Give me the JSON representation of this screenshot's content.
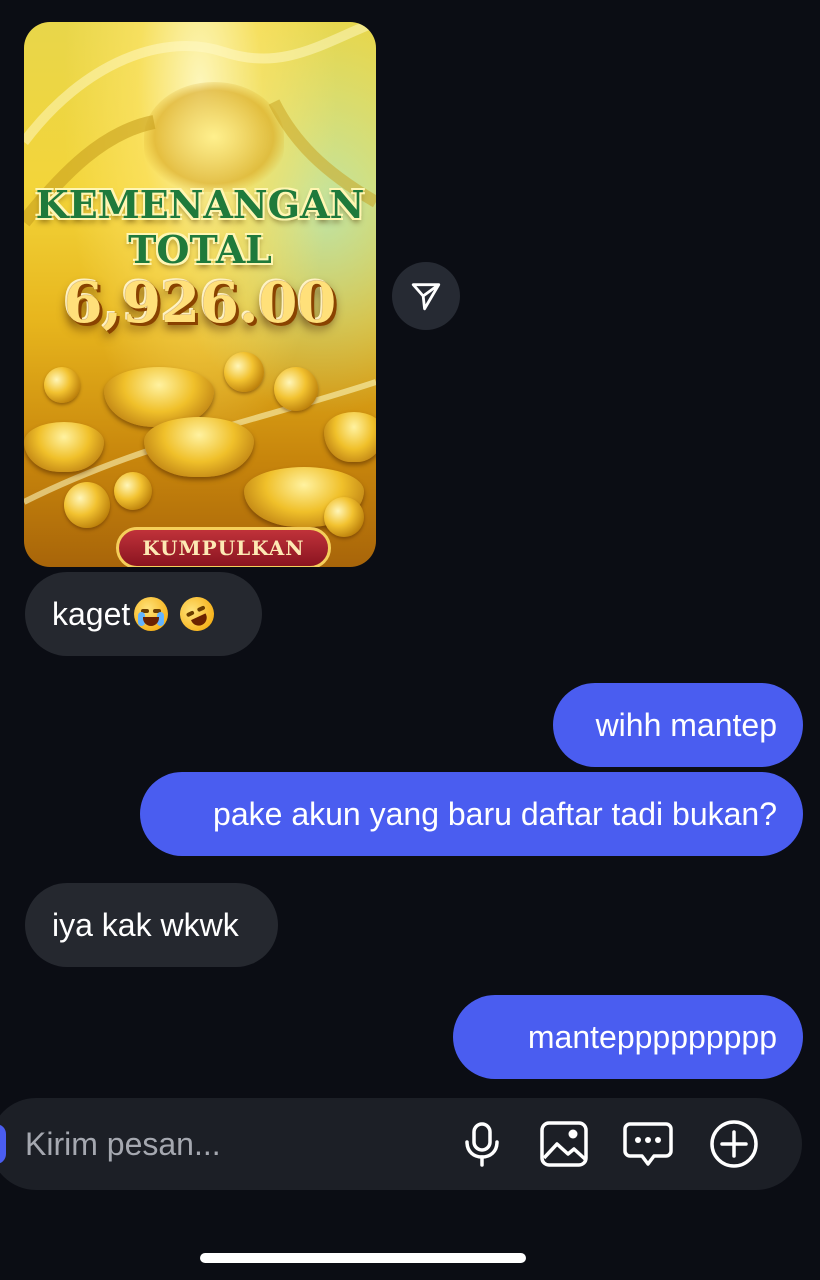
{
  "chat": {
    "image_message": {
      "title_line1": "KEMENANGAN",
      "title_line2": "TOTAL",
      "amount": "6,926.00",
      "button_label": "KUMPULKAN"
    },
    "messages": [
      {
        "from": "them",
        "text": "kaget",
        "emojis": [
          "loudly-crying-face",
          "rolling-on-floor-laughing"
        ]
      },
      {
        "from": "me",
        "text": "wihh mantep"
      },
      {
        "from": "me",
        "text": "pake akun yang baru daftar tadi bukan?"
      },
      {
        "from": "them",
        "text": "iya kak wkwk"
      },
      {
        "from": "me",
        "text": "manteppppppppp"
      }
    ]
  },
  "composer": {
    "placeholder": "Kirim pesan...",
    "icons": [
      "microphone-icon",
      "image-icon",
      "sticker-chat-icon",
      "plus-circle-icon"
    ]
  },
  "colors": {
    "background": "#0b0d14",
    "incoming_bubble": "#25282f",
    "outgoing_bubble": "#4a5df0"
  }
}
